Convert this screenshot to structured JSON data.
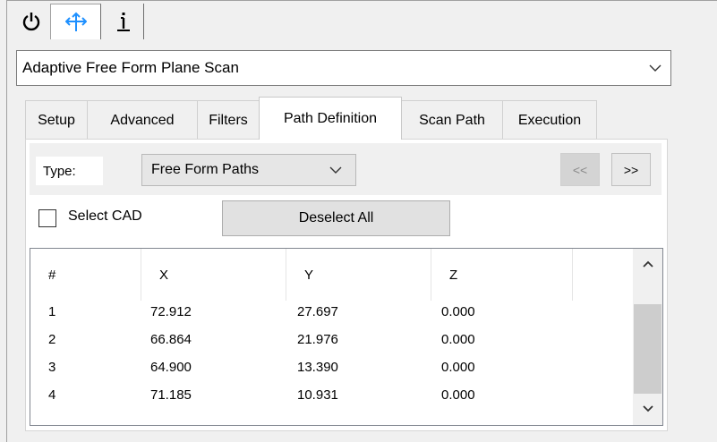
{
  "icon_tabs": [
    {
      "icon": "power-icon"
    },
    {
      "icon": "move-axes-icon",
      "color": "#1e90ff"
    },
    {
      "icon": "info-icon"
    }
  ],
  "procedure": {
    "selected": "Adaptive Free Form Plane Scan"
  },
  "tabs": [
    {
      "label": "Setup"
    },
    {
      "label": "Advanced"
    },
    {
      "label": "Filters"
    },
    {
      "label": "Path Definition",
      "active": true
    },
    {
      "label": "Scan Path"
    },
    {
      "label": "Execution"
    }
  ],
  "path": {
    "type_label": "Type:",
    "type_value": "Free Form Paths",
    "prev_label": "<<",
    "next_label": ">>",
    "select_cad_label": "Select CAD",
    "select_cad_checked": false,
    "deselect_label": "Deselect All"
  },
  "points": {
    "columns": [
      "#",
      "X",
      "Y",
      "Z"
    ],
    "rows": [
      [
        "1",
        "72.912",
        "27.697",
        "0.000"
      ],
      [
        "2",
        "66.864",
        "21.976",
        "0.000"
      ],
      [
        "3",
        "64.900",
        "13.390",
        "0.000"
      ],
      [
        "4",
        "71.185",
        "10.931",
        "0.000"
      ]
    ]
  }
}
